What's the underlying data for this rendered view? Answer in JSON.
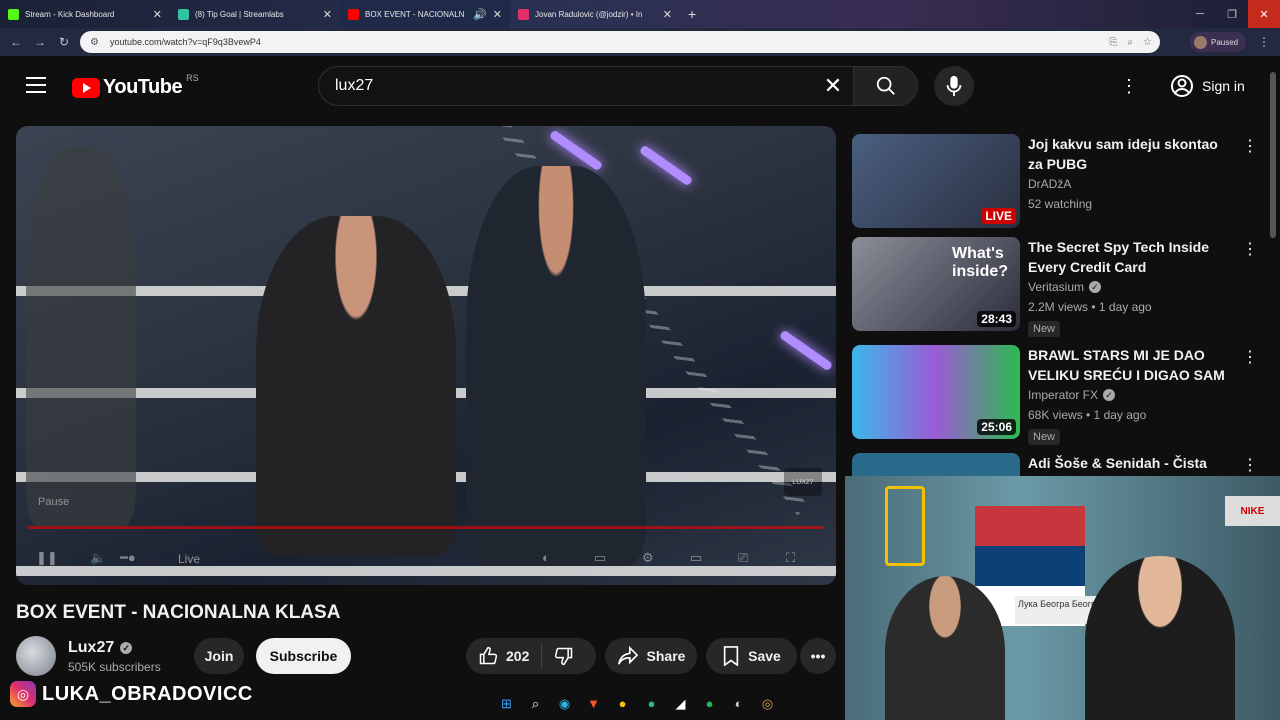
{
  "browser": {
    "tabs": [
      {
        "label": "Stream - Kick Dashboard",
        "color": "#53fc18"
      },
      {
        "label": "(8) Tip Goal | Streamlabs",
        "color": "#31c3a2"
      },
      {
        "label": "BOX EVENT - NACIONALN",
        "color": "#ff0000"
      },
      {
        "label": "Jovan Radulovic (@jodzir) • In",
        "color": "#e1306c"
      }
    ],
    "url": "youtube.com/watch?v=qF9q3BvewP4",
    "profile_label": "Paused"
  },
  "youtube": {
    "logo_text": "YouTube",
    "country_code": "RS",
    "search_query": "lux27",
    "sign_in": "Sign in"
  },
  "player": {
    "pause_label": "Pause",
    "live_label": "Live",
    "watermark": "LUX27"
  },
  "video": {
    "title": "BOX EVENT - NACIONALNA KLASA",
    "channel": "Lux27",
    "subscribers": "505K subscribers",
    "join_label": "Join",
    "subscribe_label": "Subscribe",
    "likes": "202",
    "share_label": "Share",
    "save_label": "Save"
  },
  "recommendations": [
    {
      "title": "Joj kakvu sam ideju skontao za PUBG",
      "channel": "DrADžA",
      "verified": false,
      "meta": "52 watching",
      "badge": "LIVE",
      "is_live": true,
      "new": false,
      "thumb_color": "#3a4a66"
    },
    {
      "title": "The Secret Spy Tech Inside Every Credit Card",
      "channel": "Veritasium",
      "verified": true,
      "meta": "2.2M views • 1 day ago",
      "badge": "28:43",
      "is_live": false,
      "new": true,
      "new_label": "New",
      "thumb_color": "#2c2c3a",
      "thumb_text": "What's inside?"
    },
    {
      "title": "BRAWL STARS MI JE DAO VELIKU SREĆU I DIGAO SAM ...",
      "channel": "Imperator FX",
      "verified": true,
      "meta": "68K views • 1 day ago",
      "badge": "25:06",
      "is_live": false,
      "new": true,
      "new_label": "New",
      "thumb_color": "#3bb8e8"
    },
    {
      "title": "Adi Šoše & Senidah - Čista",
      "channel": "",
      "verified": false,
      "meta": "",
      "badge": "",
      "is_live": false,
      "new": false,
      "thumb_color": "#2a6a8a"
    }
  ],
  "webcam": {
    "sign_text": "Лука Београ Беогр",
    "shoe_brand": "NIKE"
  },
  "overlay": {
    "ig_handle": "LUKA_OBRADOVICC"
  }
}
